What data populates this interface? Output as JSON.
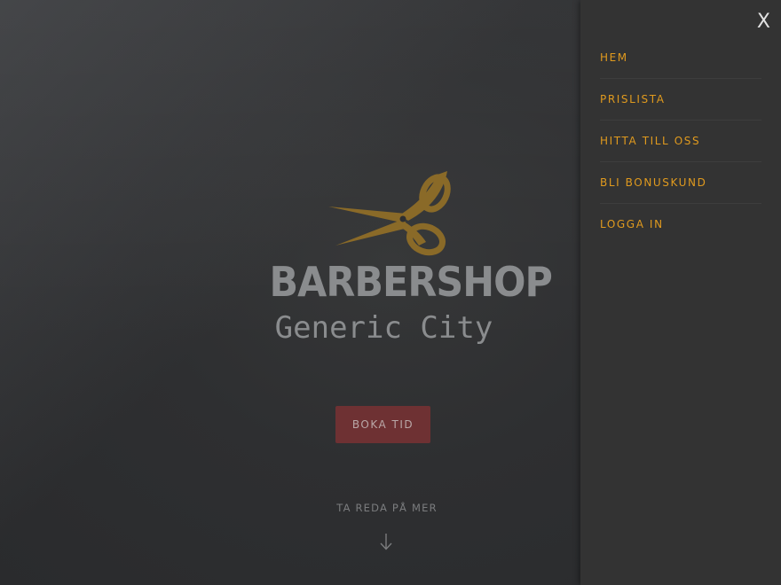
{
  "hero": {
    "logo": {
      "icon": "scissors-icon",
      "name": "BARBERSHOP",
      "city": "Generic City"
    },
    "book_button": "BOKA TID",
    "learn_more": "TA REDA PÅ MER",
    "arrow_icon": "arrow-down-icon"
  },
  "menu": {
    "close_label": "X",
    "items": [
      {
        "label": "HEM"
      },
      {
        "label": "PRISLISTA"
      },
      {
        "label": "HITTA TILL OSS"
      },
      {
        "label": "BLI BONUSKUND"
      },
      {
        "label": "LOGGA IN"
      }
    ]
  },
  "colors": {
    "accent": "#e09a1e",
    "logo_gold": "#8a6a28",
    "button": "#6e3133",
    "panel": "#333333"
  }
}
